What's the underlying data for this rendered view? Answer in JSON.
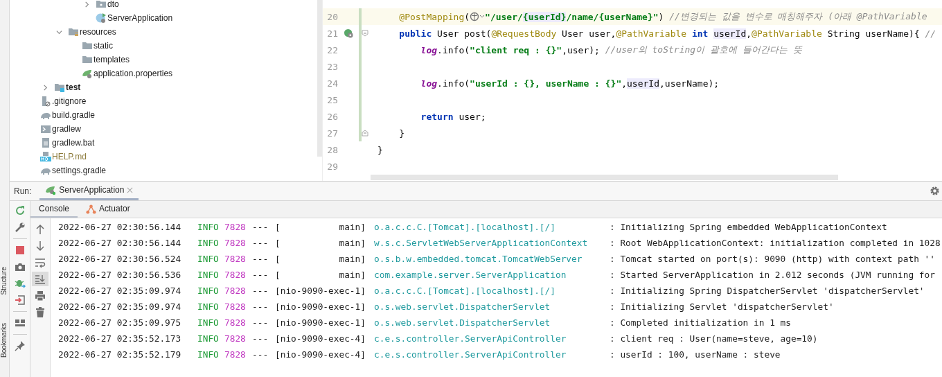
{
  "side_strip": {
    "labels": [
      "Structure",
      "Bookmarks"
    ]
  },
  "project_tree": [
    {
      "children": [
        {
          "children": [
            {
              "children": [
                {
                  "children": [
                    {
                      "label": "dto",
                      "kind": "package-folder",
                      "expanded": false,
                      "ignored": false
                    },
                    {
                      "label": "ServerApplication",
                      "kind": "spring-app",
                      "ignored": false
                    }
                  ]
                }
              ]
            },
            {
              "label": "resources",
              "kind": "resources-folder",
              "expanded": true,
              "ignored": false,
              "children": [
                {
                  "label": "static",
                  "kind": "folder",
                  "ignored": false
                },
                {
                  "label": "templates",
                  "kind": "folder",
                  "ignored": false
                },
                {
                  "label": "application.properties",
                  "kind": "spring-properties",
                  "ignored": false
                }
              ]
            }
          ]
        },
        {
          "label": "test",
          "kind": "test-folder",
          "expanded": false,
          "ignored": false,
          "bold": true
        }
      ]
    },
    {
      "label": ".gitignore",
      "kind": "ignore-file",
      "ignored": false
    },
    {
      "label": "build.gradle",
      "kind": "gradle",
      "ignored": false
    },
    {
      "label": "gradlew",
      "kind": "shell-script",
      "ignored": false
    },
    {
      "label": "gradlew.bat",
      "kind": "text-file",
      "ignored": false
    },
    {
      "label": "HELP.md",
      "kind": "markdown",
      "ignored": true
    },
    {
      "label": "settings.gradle",
      "kind": "gradle",
      "ignored": false
    }
  ],
  "editor": {
    "lines": [
      {
        "number": "20",
        "current": true,
        "changed": true,
        "bean_icon": false,
        "tokens": [
          {
            "kind": "annotation",
            "text": "    @PostMapping"
          },
          {
            "kind": "plain",
            "text": "("
          },
          {
            "kind": "url-icon"
          },
          {
            "kind": "string",
            "text": "\"/user/"
          },
          {
            "kind": "string-hl",
            "text": "{userId}"
          },
          {
            "kind": "string",
            "text": "/name/{userName}\""
          },
          {
            "kind": "plain",
            "text": ") "
          },
          {
            "kind": "comment",
            "text": "//변경되는 값을 변수로 매칭해주자 (아래 @PathVariable"
          }
        ]
      },
      {
        "number": "21",
        "current": false,
        "changed": true,
        "bean_icon": true,
        "fold_open": true,
        "tokens": [
          {
            "kind": "keyword",
            "text": "    public"
          },
          {
            "kind": "plain",
            "text": " User post("
          },
          {
            "kind": "annotation",
            "text": "@RequestBody"
          },
          {
            "kind": "plain",
            "text": " User user,"
          },
          {
            "kind": "annotation",
            "text": "@PathVariable"
          },
          {
            "kind": "keyword",
            "text": " int "
          },
          {
            "kind": "ident-hl",
            "text": "userId"
          },
          {
            "kind": "plain",
            "text": ","
          },
          {
            "kind": "annotation",
            "text": "@PathVariable"
          },
          {
            "kind": "plain",
            "text": " String userName){ "
          },
          {
            "kind": "comment",
            "text": "//"
          }
        ]
      },
      {
        "number": "22",
        "current": false,
        "changed": true,
        "bean_icon": false,
        "tokens": [
          {
            "kind": "field",
            "text": "        log"
          },
          {
            "kind": "plain",
            "text": ".info("
          },
          {
            "kind": "string",
            "text": "\"client req : {}\""
          },
          {
            "kind": "plain",
            "text": ",user); "
          },
          {
            "kind": "comment",
            "text": "//user의 toString이 괄호에 들어간다는 뜻"
          }
        ]
      },
      {
        "number": "23",
        "current": false,
        "changed": true,
        "bean_icon": false
      },
      {
        "number": "24",
        "current": false,
        "changed": true,
        "bean_icon": false,
        "tokens": [
          {
            "kind": "field",
            "text": "        log"
          },
          {
            "kind": "plain",
            "text": ".info("
          },
          {
            "kind": "string",
            "text": "\"userId : {}, userName : {}\""
          },
          {
            "kind": "plain",
            "text": ","
          },
          {
            "kind": "ident-hl",
            "text": "userId"
          },
          {
            "kind": "plain",
            "text": ",userName);"
          }
        ]
      },
      {
        "number": "25",
        "current": false,
        "changed": true,
        "bean_icon": false
      },
      {
        "number": "26",
        "current": false,
        "changed": true,
        "bean_icon": false,
        "tokens": [
          {
            "kind": "keyword",
            "text": "        return"
          },
          {
            "kind": "plain",
            "text": " user;"
          }
        ]
      },
      {
        "number": "27",
        "current": false,
        "changed": true,
        "bean_icon": false,
        "fold_close": true,
        "tokens": [
          {
            "kind": "plain",
            "text": "    }"
          }
        ]
      },
      {
        "number": "28",
        "current": false,
        "changed": false,
        "bean_icon": false,
        "tokens": [
          {
            "kind": "plain",
            "text": "}"
          }
        ]
      },
      {
        "number": "29",
        "current": false,
        "changed": false,
        "bean_icon": false
      }
    ]
  },
  "run_panel": {
    "label": "Run:",
    "tabs": [
      {
        "label": "ServerApplication",
        "selected": true
      }
    ],
    "console_tabs": [
      {
        "label": "Console",
        "selected": true,
        "icon": false
      },
      {
        "label": "Actuator",
        "selected": false,
        "icon": true
      }
    ],
    "toolbar": [
      {
        "kind": "rerun"
      },
      {
        "kind": "wrench"
      },
      {
        "kind": "separator"
      },
      {
        "kind": "stop"
      },
      {
        "kind": "camera"
      },
      {
        "kind": "bug"
      },
      {
        "kind": "exit"
      },
      {
        "kind": "separator"
      },
      {
        "kind": "layout"
      },
      {
        "kind": "separator"
      },
      {
        "kind": "pin"
      }
    ],
    "console_toolbar": [
      {
        "kind": "up",
        "on": false
      },
      {
        "kind": "down",
        "on": false
      },
      {
        "kind": "wrap",
        "on": false
      },
      {
        "kind": "scroll-end",
        "on": true
      },
      {
        "kind": "print",
        "on": false
      },
      {
        "kind": "trash",
        "on": false
      }
    ],
    "log_rows": [
      {
        "time": "2022-06-27 02:30:56.144",
        "level": "INFO",
        "pid": "7828",
        "sep": "---",
        "thread": "[           main]",
        "logger": "o.a.c.c.C.[Tomcat].[localhost].[/]",
        "message": ": Initializing Spring embedded WebApplicationContext"
      },
      {
        "time": "2022-06-27 02:30:56.144",
        "level": "INFO",
        "pid": "7828",
        "sep": "---",
        "thread": "[           main]",
        "logger": "w.s.c.ServletWebServerApplicationContext",
        "message": ": Root WebApplicationContext: initialization completed in 1028"
      },
      {
        "time": "2022-06-27 02:30:56.524",
        "level": "INFO",
        "pid": "7828",
        "sep": "---",
        "thread": "[           main]",
        "logger": "o.s.b.w.embedded.tomcat.TomcatWebServer",
        "message": ": Tomcat started on port(s): 9090 (http) with context path ''"
      },
      {
        "time": "2022-06-27 02:30:56.536",
        "level": "INFO",
        "pid": "7828",
        "sep": "---",
        "thread": "[           main]",
        "logger": "com.example.server.ServerApplication",
        "message": ": Started ServerApplication in 2.012 seconds (JVM running for"
      },
      {
        "time": "2022-06-27 02:35:09.974",
        "level": "INFO",
        "pid": "7828",
        "sep": "---",
        "thread": "[nio-9090-exec-1]",
        "logger": "o.a.c.c.C.[Tomcat].[localhost].[/]",
        "message": ": Initializing Spring DispatcherServlet 'dispatcherServlet'"
      },
      {
        "time": "2022-06-27 02:35:09.974",
        "level": "INFO",
        "pid": "7828",
        "sep": "---",
        "thread": "[nio-9090-exec-1]",
        "logger": "o.s.web.servlet.DispatcherServlet",
        "message": ": Initializing Servlet 'dispatcherServlet'"
      },
      {
        "time": "2022-06-27 02:35:09.975",
        "level": "INFO",
        "pid": "7828",
        "sep": "---",
        "thread": "[nio-9090-exec-1]",
        "logger": "o.s.web.servlet.DispatcherServlet",
        "message": ": Completed initialization in 1 ms"
      },
      {
        "time": "2022-06-27 02:35:52.173",
        "level": "INFO",
        "pid": "7828",
        "sep": "---",
        "thread": "[nio-9090-exec-4]",
        "logger": "c.e.s.controller.ServerApiController",
        "message": ": client req : User(name=steve, age=10)"
      },
      {
        "time": "2022-06-27 02:35:52.179",
        "level": "INFO",
        "pid": "7828",
        "sep": "---",
        "thread": "[nio-9090-exec-4]",
        "logger": "c.e.s.controller.ServerApiController",
        "message": ": userId : 100, userName : steve"
      }
    ]
  }
}
